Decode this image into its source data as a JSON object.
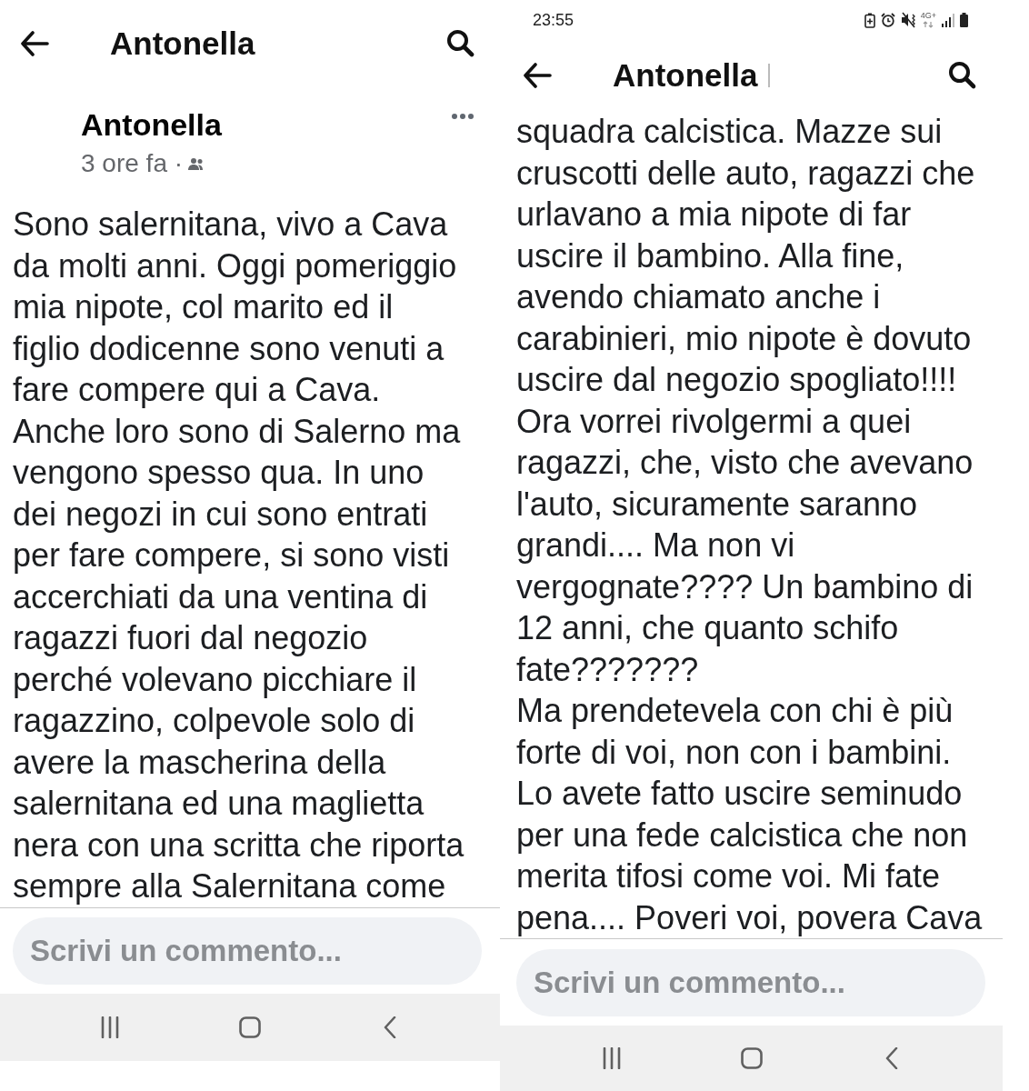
{
  "screens": [
    {
      "header": {
        "title": "Antonella"
      },
      "post": {
        "author": "Antonella",
        "time": "3 ore fa ·"
      },
      "text_lines": [
        "Sono salernitana, vivo a Cava",
        "da molti anni. Oggi pomeriggio",
        "mia nipote, col marito ed il",
        "figlio dodicenne sono venuti a",
        "fare compere qui a Cava.",
        "Anche loro sono di Salerno ma",
        "vengono spesso qua. In uno",
        "dei negozi in cui sono entrati",
        "per fare compere, si sono visti",
        "accerchiati da una ventina di",
        "ragazzi fuori dal negozio",
        "perché volevano picchiare il",
        "ragazzino, colpevole solo di",
        "avere la mascherina della",
        "salernitana ed una maglietta",
        "nera con una scritta che riporta",
        "sempre alla Salernitana come"
      ],
      "comment_field": {
        "placeholder": "Scrivi un commento..."
      }
    },
    {
      "status_bar": {
        "time": "23:55",
        "network": "4G+"
      },
      "header": {
        "title": "Antonella"
      },
      "text_lines": [
        "squadra calcistica. Mazze sui",
        "cruscotti delle auto, ragazzi che",
        "urlavano a mia nipote di far",
        "uscire il bambino. Alla fine,",
        "avendo chiamato anche i",
        "carabinieri, mio nipote è dovuto",
        "uscire dal negozio spogliato!!!!",
        "Ora vorrei rivolgermi a quei",
        "ragazzi, che, visto che avevano",
        "l'auto, sicuramente saranno",
        "grandi.... Ma non vi",
        "vergognate???? Un bambino di",
        "12 anni, che quanto schifo",
        "fate???????",
        "Ma prendetevela con chi è più",
        "forte di voi, non con i bambini.",
        "Lo avete fatto uscire seminudo",
        "per una fede calcistica che non",
        "merita tifosi come voi. Mi fate",
        "pena.... Poveri voi, povera Cava"
      ],
      "comment_field": {
        "placeholder": "Scrivi un commento..."
      }
    }
  ]
}
